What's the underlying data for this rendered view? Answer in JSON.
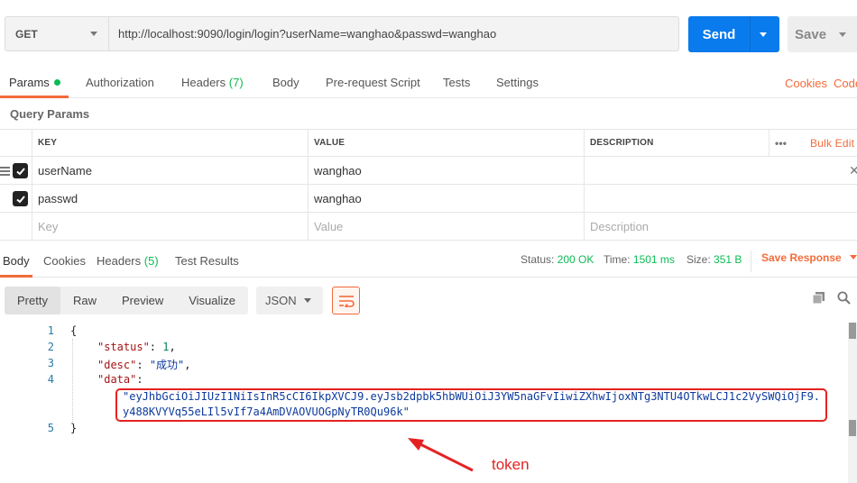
{
  "request": {
    "method": "GET",
    "url": "http://localhost:9090/login/login?userName=wanghao&passwd=wanghao",
    "send_label": "Send",
    "save_label": "Save"
  },
  "request_tabs": {
    "params": "Params",
    "authorization": "Authorization",
    "headers": "Headers",
    "headers_count": "(7)",
    "body": "Body",
    "prerequest": "Pre-request Script",
    "tests": "Tests",
    "settings": "Settings",
    "cookies": "Cookies",
    "code": "Code"
  },
  "query_params": {
    "title": "Query Params",
    "columns": {
      "key": "KEY",
      "value": "VALUE",
      "description": "DESCRIPTION"
    },
    "bulk_edit": "Bulk Edit",
    "more": "•••",
    "rows": [
      {
        "key": "userName",
        "value": "wanghao",
        "checked": true
      },
      {
        "key": "passwd",
        "value": "wanghao",
        "checked": true
      }
    ],
    "placeholders": {
      "key": "Key",
      "value": "Value",
      "description": "Description"
    }
  },
  "response_tabs": {
    "body": "Body",
    "cookies": "Cookies",
    "headers": "Headers",
    "headers_count": "(5)",
    "test_results": "Test Results"
  },
  "response_meta": {
    "status_label": "Status:",
    "status_value": "200 OK",
    "time_label": "Time:",
    "time_value": "1501 ms",
    "size_label": "Size:",
    "size_value": "351 B",
    "save_response": "Save Response"
  },
  "body_toolbar": {
    "pretty": "Pretty",
    "raw": "Raw",
    "preview": "Preview",
    "visualize": "Visualize",
    "format": "JSON"
  },
  "code": {
    "line_numbers": [
      "1",
      "2",
      "3",
      "4",
      "5"
    ],
    "open_brace": "{",
    "status_key": "\"status\"",
    "status_value": "1",
    "desc_key": "\"desc\"",
    "desc_value": "\"成功\"",
    "data_key": "\"data\"",
    "token_line1": "\"eyJhbGciOiJIUzI1NiIsInR5cCI6IkpXVCJ9.eyJsb2dpbk5hbWUiOiJ3YW5naGFvIiwiZXhwIjoxNTg3NTU4OTkwLCJ1c2VySWQiOjF9.",
    "token_line2": "y488KVYVq55eLIl5vIf7a4AmDVAOVUOGpNyTR0Qu96k\"",
    "close_brace": "}"
  },
  "annotation": {
    "label": "token",
    "color": "#e52222"
  },
  "colors": {
    "accent": "#f26b3a",
    "send": "#097bed",
    "success": "#0cbb52"
  }
}
